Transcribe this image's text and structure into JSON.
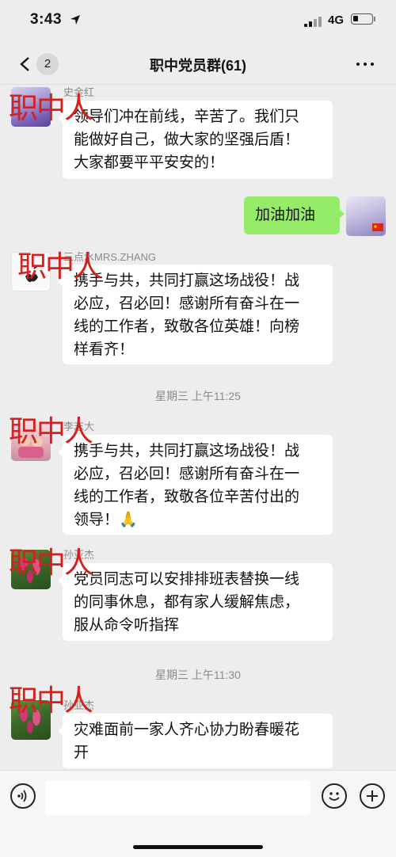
{
  "status_bar": {
    "time": "3:43",
    "network": "4G"
  },
  "header": {
    "unread_count": "2",
    "title": "职中党员群(61)"
  },
  "watermark_text": "职中人",
  "messages": [
    {
      "sender": "史金红",
      "lines": [
        "领导们冲在前线，辛苦了。我们只",
        "能做好自己，做大家的坚强后盾！",
        "大家都要平平安安的！"
      ]
    },
    {
      "mine": true,
      "lines": [
        "加油加油"
      ]
    },
    {
      "sender": "三点水MRS.ZHANG",
      "lines": [
        "携手与共，共同打赢这场战役！战",
        "必应，召必回！感谢所有奋斗在一",
        "线的工作者，致敬各位英雄！向榜",
        "样看齐！"
      ]
    },
    {
      "timestamp": "星期三 上午11:25"
    },
    {
      "sender": "李志大",
      "lines": [
        "携手与共，共同打赢这场战役！战",
        "必应，召必回！感谢所有奋斗在一",
        "线的工作者，致敬各位辛苦付出的",
        "领导！🙏"
      ]
    },
    {
      "sender": "孙亚杰",
      "lines": [
        "党员同志可以安排排班表替换一线",
        "的同事休息，都有家人缓解焦虑，",
        "服从命令听指挥"
      ]
    },
    {
      "timestamp": "星期三 上午11:30"
    },
    {
      "sender": "孙亚杰",
      "lines": [
        "灾难面前一家人齐心协力盼春暖花",
        "开"
      ]
    }
  ],
  "colors": {
    "background": "#ededed",
    "my_bubble": "#95ec69",
    "watermark": "#d4201f"
  }
}
